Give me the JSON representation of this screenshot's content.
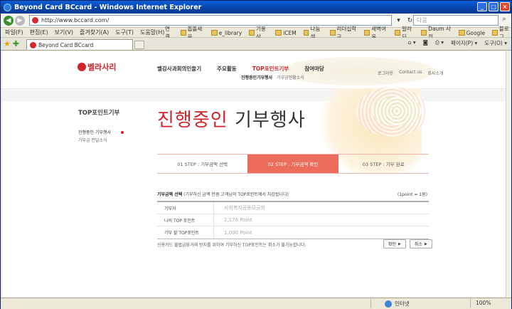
{
  "window": {
    "title": "Beyond Card BCcard - Windows Internet Explorer"
  },
  "address": {
    "url": "http://www.bccard.com/",
    "search_placeholder": "다음"
  },
  "menu": [
    "파일(F)",
    "편집(E)",
    "보기(V)",
    "즐겨찾기(A)",
    "도구(T)",
    "도움말(H)"
  ],
  "links": {
    "label": "연결",
    "items": [
      "돕돌새음",
      "e_library",
      "기용상",
      "iCEM",
      "나눔셀",
      "리더십학교",
      "새벽여울",
      "알라딘",
      "Daum 사전",
      "Google",
      "블로그"
    ]
  },
  "tab": {
    "label": "Beyond Card BCcard"
  },
  "commandbar": [
    "페이지(P) ▾",
    "도구(O) ▾"
  ],
  "site": {
    "logo_text": "벨라사리",
    "gnb": [
      "벨강사과회의인들기",
      "주요활동",
      "TOP포인트기부",
      "참여마당"
    ],
    "subgnb": [
      "진행중인기부행사",
      "기부금현황소식"
    ],
    "util": [
      "로그아웃",
      "Contact us",
      "회사소개"
    ]
  },
  "lnb": {
    "title": "TOP포인트기부",
    "item1": "진행중인 기부행사",
    "item2": "기부금 전달소식"
  },
  "page_title": {
    "red": "진행중인",
    "black": "기부행사"
  },
  "steps": [
    "01 STEP : 기부금액 선택",
    "02 STEP : 기부금액 확인",
    "03 STEP : 기부 완료"
  ],
  "section": {
    "title": "기부금액 선택",
    "desc": "(기부하신 금액 만큼 고객님의 TOP포인트에서 차감됩니다)",
    "ratio": "(1point = 1원)"
  },
  "table": [
    {
      "label": "기부처",
      "value": "사회복지공동모금회"
    },
    {
      "label": "나의 TOP 포인트",
      "value": "2,176 Point"
    },
    {
      "label": "기부 할 TOP포인트",
      "value": "1,000 Point"
    }
  ],
  "notice": "신용카드 불법금융거래 방지를 위하여 기부하신 TOP포인트는 취소가 불가능합니다.",
  "buttons": {
    "confirm": "확인",
    "cancel": "취소"
  },
  "status": {
    "zone": "인터넷",
    "zoom": "100%"
  }
}
